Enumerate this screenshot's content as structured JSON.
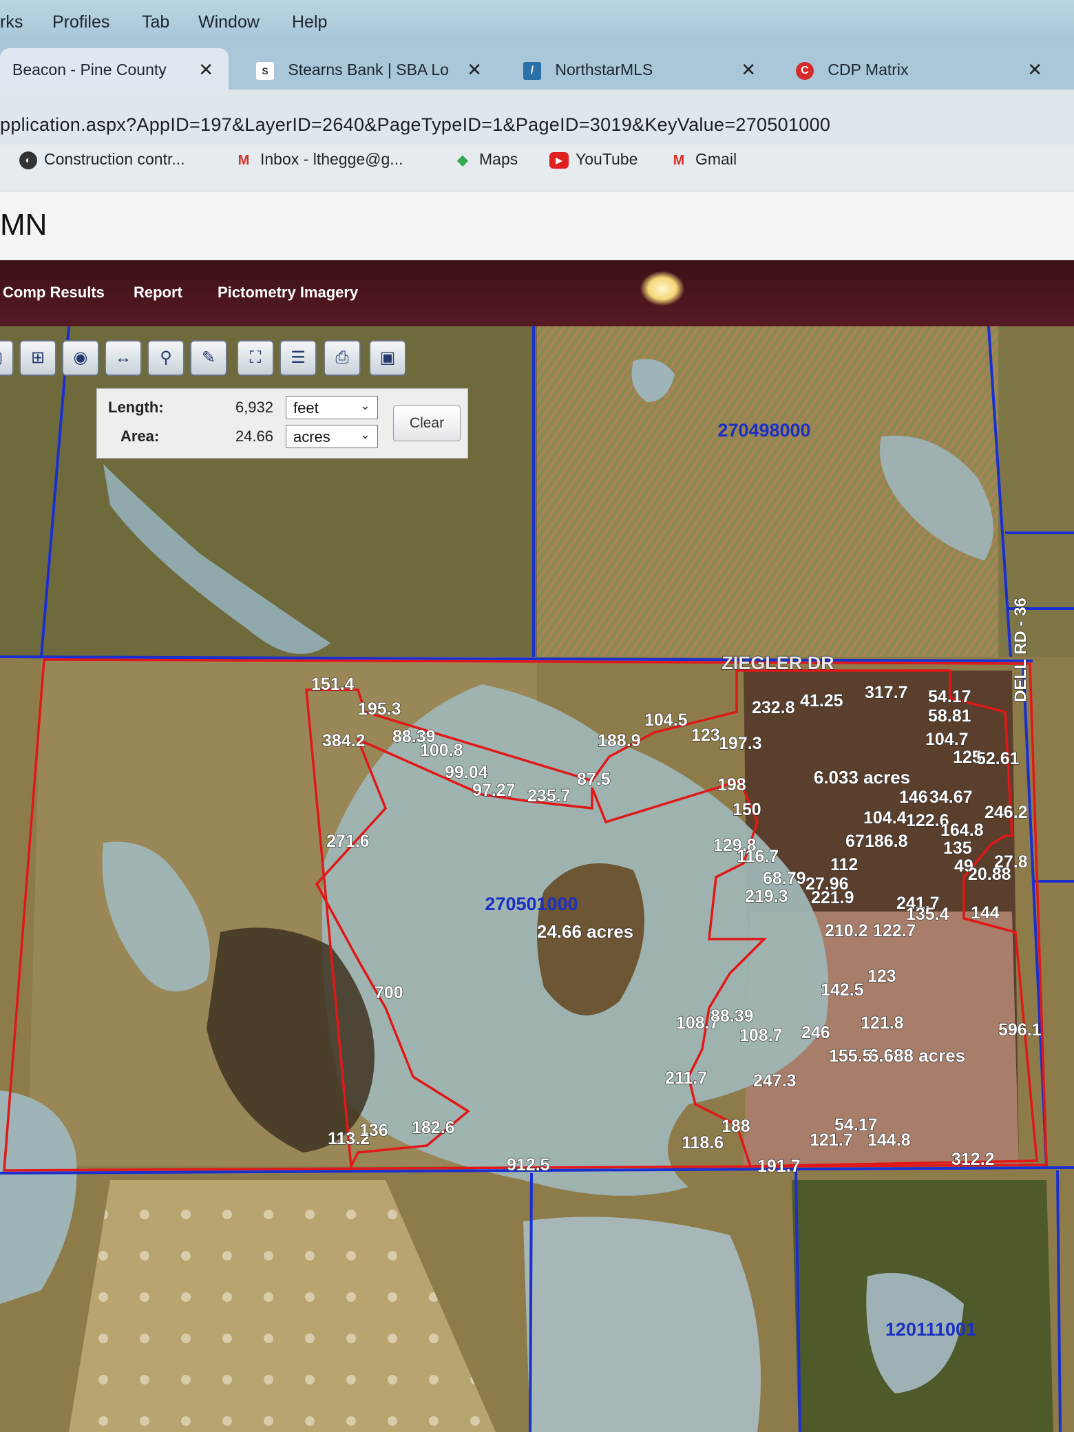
{
  "menubar": {
    "items": [
      "rks",
      "Profiles",
      "Tab",
      "Window",
      "Help"
    ]
  },
  "tabs": [
    {
      "label": "Beacon - Pine County",
      "close": "✕",
      "icon": ""
    },
    {
      "label": "Stearns Bank | SBA Lo",
      "close": "✕",
      "icon": "S"
    },
    {
      "label": "NorthstarMLS",
      "close": "✕",
      "icon": "/"
    },
    {
      "label": "CDP Matrix",
      "close": "✕",
      "icon": "C"
    }
  ],
  "address": {
    "url": "pplication.aspx?AppID=197&LayerID=2640&PageTypeID=1&PageID=3019&KeyValue=270501000"
  },
  "bookmarks": [
    "Construction contr...",
    "Inbox - lthegge@g...",
    "Maps",
    "YouTube",
    "Gmail"
  ],
  "site": {
    "title": "MN"
  },
  "nav": {
    "items": [
      "Comp Results",
      "Report",
      "Pictometry Imagery"
    ]
  },
  "toolbar": {
    "icons": [
      "select-icon",
      "zoom-box-icon",
      "camera-icon",
      "measure-icon",
      "search-icon",
      "pencil-icon",
      "full-extent-icon",
      "layers-icon",
      "print-icon",
      "save-icon"
    ]
  },
  "measure": {
    "length_label": "Length:",
    "length_value": "6,932",
    "length_unit": "feet",
    "area_label": "Area:",
    "area_value": "24.66",
    "area_unit": "acres",
    "clear_label": "Clear"
  },
  "map": {
    "parcels": [
      "270498000",
      "270501000",
      "120111001"
    ],
    "road_labels": [
      "ZIEGLER DR",
      "DELL RD - 36"
    ],
    "area_labels": [
      "24.66 acres",
      "6.033 acres",
      "6.688 acres"
    ],
    "dimensions": [
      "151.4",
      "195.3",
      "384.2",
      "88.39",
      "100.8",
      "99.04",
      "97.27",
      "235.7",
      "87.5",
      "188.9",
      "104.5",
      "123",
      "197.3",
      "232.8",
      "41.25",
      "317.7",
      "54.17",
      "58.81",
      "104.7",
      "125",
      "52.61",
      "198",
      "150",
      "146",
      "34.67",
      "104.4",
      "122.6",
      "246.2",
      "164.8",
      "67",
      "186.8",
      "135",
      "129.8",
      "116.7",
      "112",
      "49",
      "27.8",
      "20.88",
      "68.79",
      "27.96",
      "219.3",
      "221.9",
      "241.7",
      "135.4",
      "144",
      "210.2",
      "122.7",
      "271.6",
      "123",
      "142.5",
      "700",
      "108.7",
      "88.39",
      "108.7",
      "246",
      "121.8",
      "596.1",
      "155.5",
      "211.7",
      "247.3",
      "188",
      "54.17",
      "113.2",
      "136",
      "182.6",
      "118.6",
      "121.7",
      "144.8",
      "912.5",
      "191.7",
      "312.2"
    ],
    "colors": {
      "parcel_line": "#1a2fd0",
      "selection": "#e01818",
      "label_blue": "#1b2fc2"
    }
  }
}
